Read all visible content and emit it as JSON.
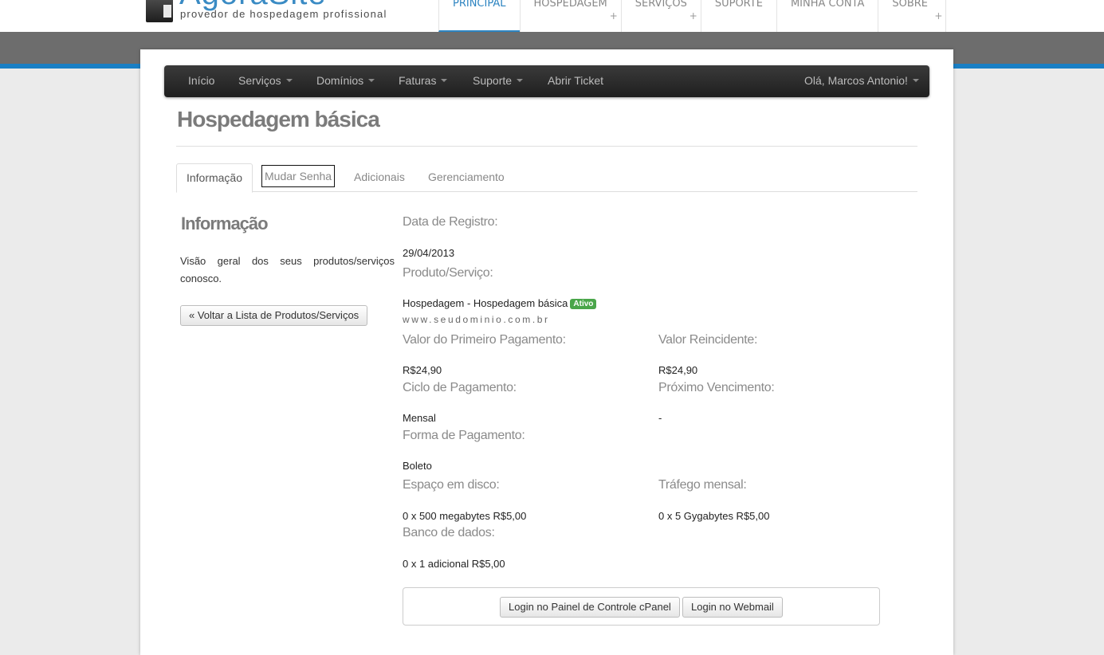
{
  "brand": {
    "name": "AgoraSite",
    "tagline": "provedor de hospedagem profissional"
  },
  "main_nav": [
    {
      "label": "PRINCIPAL",
      "active": true,
      "has_sub": false
    },
    {
      "label": "HOSPEDAGEM",
      "active": false,
      "has_sub": true
    },
    {
      "label": "SERVIÇOS",
      "active": false,
      "has_sub": true
    },
    {
      "label": "SUPORTE",
      "active": false,
      "has_sub": false
    },
    {
      "label": "MINHA CONTA",
      "active": false,
      "has_sub": false
    },
    {
      "label": "SOBRE",
      "active": false,
      "has_sub": true
    }
  ],
  "main_nav_plus": "+",
  "client_nav": {
    "items": [
      "Início",
      "Serviços",
      "Domínios",
      "Faturas",
      "Suporte",
      "Abrir Ticket"
    ],
    "user": "Olá, Marcos Antonio!"
  },
  "page_title": "Hospedagem básica",
  "tabs": [
    "Informação",
    "Mudar Senha",
    "Adicionais",
    "Gerenciamento"
  ],
  "sidebar": {
    "title": "Informação",
    "description": "Visão geral dos seus produtos/serviços conosco.",
    "back_button": "« Voltar a Lista de Produtos/Serviços"
  },
  "details": {
    "registration_label": "Data de Registro:",
    "registration_value": "29/04/2013",
    "product_label": "Produto/Serviço:",
    "product_value": "Hospedagem - Hospedagem básica",
    "status": "Ativo",
    "domain": "www.seudominio.com.br",
    "first_payment_label": "Valor do Primeiro Pagamento:",
    "first_payment_value": "R$24,90",
    "recurring_label": "Valor Reincidente:",
    "recurring_value": "R$24,90",
    "cycle_label": "Ciclo de Pagamento:",
    "cycle_value": "Mensal",
    "next_due_label": "Próximo Vencimento:",
    "next_due_value": "-",
    "payment_method_label": "Forma de Pagamento:",
    "payment_method_value": "Boleto",
    "disk_label": "Espaço em disco:",
    "disk_value": "0 x 500 megabytes R$5,00",
    "traffic_label": "Tráfego mensal:",
    "traffic_value": "0 x 5 Gygabytes R$5,00",
    "db_label": "Banco de dados:",
    "db_value": "0 x 1 adicional R$5,00"
  },
  "login_buttons": {
    "cpanel": "Login no Painel de Controle cPanel",
    "webmail": "Login no Webmail"
  },
  "colors": {
    "accent_blue": "#1a7fc4",
    "badge_green": "#4aa64a",
    "navbar_dark": "#2a2a2a"
  }
}
